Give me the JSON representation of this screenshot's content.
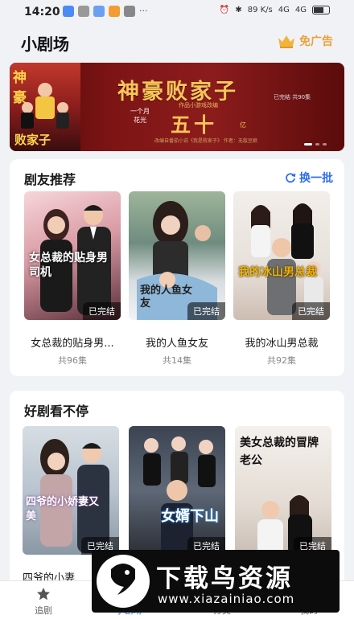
{
  "status_bar": {
    "time": "14:20",
    "net_speed": "89 K/s",
    "signal1": "4G",
    "signal2": "4G"
  },
  "header": {
    "title": "小剧场",
    "ad_free_label": "免广告"
  },
  "banner": {
    "poster_top": "神豪",
    "poster_bottom": "败家子",
    "title": "神豪败家子",
    "status": "已完结 共90集",
    "line1": "一个月",
    "line2": "花光",
    "big": "五十",
    "unit": "亿",
    "subtitle": "作品小游戏改编",
    "footer": "改编自番茄小说《我是败家子》 作者：无敌豆娘"
  },
  "section1": {
    "title": "剧友推荐",
    "refresh_label": "换一批",
    "items": [
      {
        "title": "女总裁的贴身男...",
        "episodes": "共96集",
        "status": "已完结",
        "poster_text": "女总裁的贴身男司机"
      },
      {
        "title": "我的人鱼女友",
        "episodes": "共14集",
        "status": "已完结",
        "poster_text": "我的人鱼女友"
      },
      {
        "title": "我的冰山男总裁",
        "episodes": "共92集",
        "status": "已完结",
        "poster_text": "我的冰山男总裁"
      }
    ]
  },
  "section2": {
    "title": "好剧看不停",
    "items": [
      {
        "title": "四爷的小妻",
        "status": "已完结",
        "poster_text": "四爷的小娇妻又美"
      },
      {
        "title": "",
        "status": "已完结",
        "poster_text": "女婿下山"
      },
      {
        "title": "",
        "status": "已完结",
        "poster_text": "美女总裁的冒牌老公"
      }
    ]
  },
  "bottom_nav": {
    "items": [
      "追剧",
      "小剧场",
      "分类",
      "我的"
    ]
  },
  "watermark": {
    "text": "下载鸟资源",
    "url": "www.xiazainiao.com"
  }
}
